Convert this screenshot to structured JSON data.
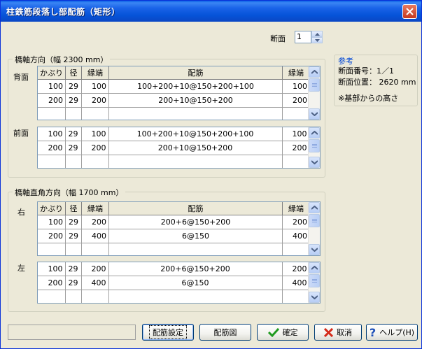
{
  "window": {
    "title": "柱鉄筋段落し部配筋（矩形）"
  },
  "section": {
    "label": "断面",
    "value": "1"
  },
  "bridge_axis": {
    "legend": "橋軸方向（幅 2300 mm）",
    "back": {
      "label": "背面",
      "headers": [
        "かぶり",
        "径",
        "縁端",
        "配筋",
        "縁端"
      ],
      "rows": [
        [
          "100",
          "29",
          "100",
          "100+200+10@150+200+100",
          "100"
        ],
        [
          "200",
          "29",
          "200",
          "200+10@150+200",
          "200"
        ],
        [
          "",
          "",
          "",
          "",
          ""
        ]
      ]
    },
    "front": {
      "label": "前面",
      "rows": [
        [
          "100",
          "29",
          "100",
          "100+200+10@150+200+100",
          "100"
        ],
        [
          "200",
          "29",
          "200",
          "200+10@150+200",
          "200"
        ],
        [
          "",
          "",
          "",
          "",
          ""
        ]
      ]
    }
  },
  "cross_axis": {
    "legend": "橋軸直角方向（幅 1700 mm）",
    "right": {
      "label": "右",
      "headers": [
        "かぶり",
        "径",
        "縁端",
        "配筋",
        "縁端"
      ],
      "rows": [
        [
          "100",
          "29",
          "200",
          "200+6@150+200",
          "200"
        ],
        [
          "200",
          "29",
          "400",
          "6@150",
          "400"
        ],
        [
          "",
          "",
          "",
          "",
          ""
        ]
      ]
    },
    "left": {
      "label": "左",
      "rows": [
        [
          "100",
          "29",
          "200",
          "200+6@150+200",
          "200"
        ],
        [
          "200",
          "29",
          "400",
          "6@150",
          "400"
        ],
        [
          "",
          "",
          "",
          "",
          ""
        ]
      ]
    }
  },
  "reference": {
    "title": "参考",
    "section_no": "断面番号：1／1",
    "section_pos": "断面位置： 2620 mm",
    "note": "※基部からの高さ"
  },
  "buttons": {
    "rebar_settings": "配筋設定",
    "rebar_diagram": "配筋図",
    "ok": "確定",
    "cancel": "取消",
    "help": "ヘルプ(H)"
  },
  "colors": {
    "titlebar": "#0553d8",
    "ok_check": "#1f9a1f",
    "cancel_x": "#d42a1a",
    "help_q": "#1d4fb8"
  }
}
